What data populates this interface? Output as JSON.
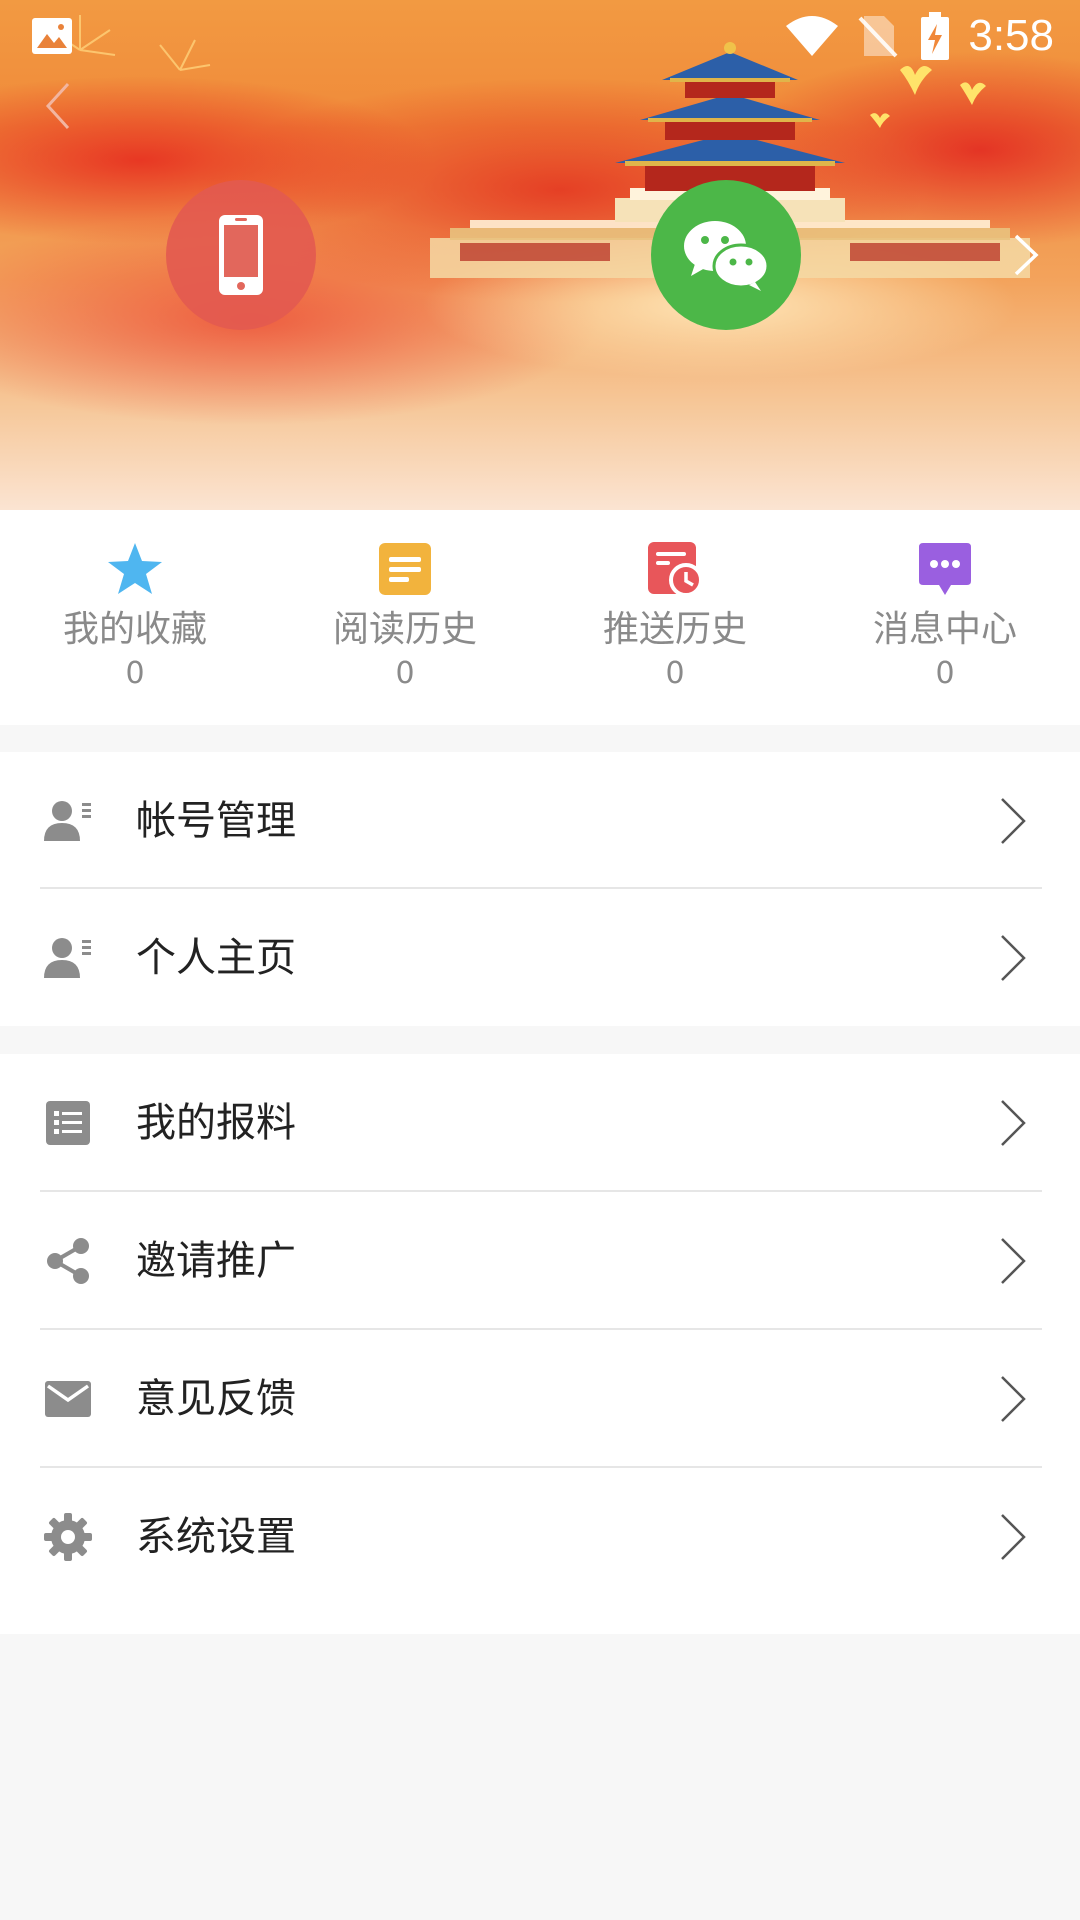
{
  "status_bar": {
    "time": "3:58"
  },
  "stats": [
    {
      "label": "我的收藏",
      "count": "0",
      "icon": "star-icon",
      "color": "#4fb6f0"
    },
    {
      "label": "阅读历史",
      "count": "0",
      "icon": "document-icon",
      "color": "#f2b33d"
    },
    {
      "label": "推送历史",
      "count": "0",
      "icon": "push-history-icon",
      "color": "#e8565a"
    },
    {
      "label": "消息中心",
      "count": "0",
      "icon": "message-icon",
      "color": "#9a5fe0"
    }
  ],
  "menu_group1": [
    {
      "label": "帐号管理",
      "icon": "account-card-icon"
    },
    {
      "label": "个人主页",
      "icon": "profile-card-icon"
    }
  ],
  "menu_group2": [
    {
      "label": "我的报料",
      "icon": "list-icon"
    },
    {
      "label": "邀请推广",
      "icon": "share-icon"
    },
    {
      "label": "意见反馈",
      "icon": "mail-icon"
    },
    {
      "label": "系统设置",
      "icon": "gear-icon"
    }
  ],
  "colors": {
    "wechat_green": "#4cb748",
    "icon_gray": "#8c8c8c",
    "text_dark": "#222222"
  }
}
